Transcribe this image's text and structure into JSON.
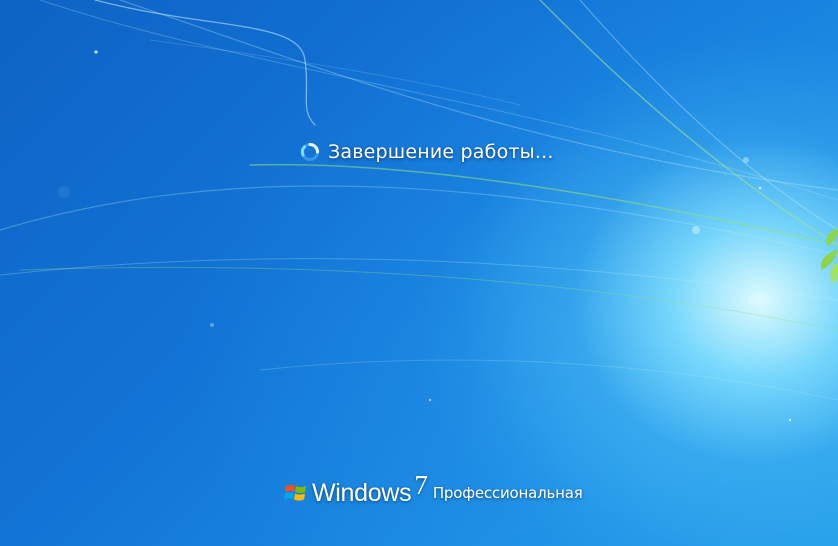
{
  "status": {
    "message": "Завершение работы...",
    "icon": "busy-spinner-icon"
  },
  "branding": {
    "logo_icon": "windows-flag-icon",
    "product_name": "Windows",
    "version": "7",
    "edition": "Профессиональная"
  },
  "colors": {
    "background_dark": "#0e63c4",
    "background_light": "#27a5ea",
    "glow": "#e6ffff",
    "text": "#ffffff",
    "leaf_green": "#8fd44a",
    "spinner_ring": "#7fe0ff"
  }
}
